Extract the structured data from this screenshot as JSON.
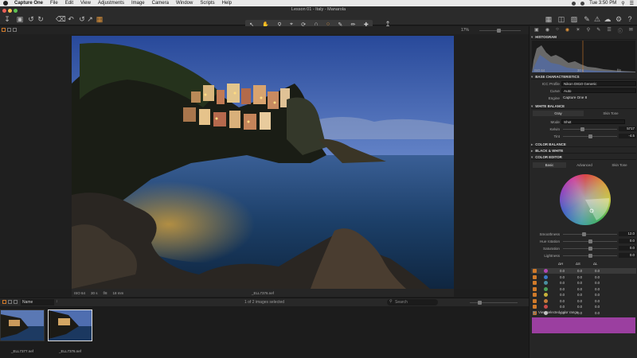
{
  "menubar": {
    "items": [
      "Capture One",
      "File",
      "Edit",
      "View",
      "Adjustments",
      "Image",
      "Camera",
      "Window",
      "Scripts",
      "Help"
    ],
    "clock": "Tue 3:50 PM"
  },
  "window": {
    "title": "Lesson 01 - Italy - Manarola"
  },
  "viewer": {
    "zoom": "17%",
    "info": {
      "iso": "ISO 64",
      "shutter": "30 s",
      "aperture": "f/8",
      "focal": "18 mm"
    },
    "filename": "_ELL7376.nef"
  },
  "browser": {
    "sort_label": "Name",
    "selection_count": "1 of 2 images selected",
    "search_placeholder": "Search",
    "thumbs": [
      {
        "name": "_ELL7377.nef"
      },
      {
        "name": "_ELL7376.nef"
      }
    ]
  },
  "panel": {
    "histogram": {
      "title": "HISTOGRAM",
      "iso": "ISO 64",
      "shutter": "30 s",
      "aperture": "f/8"
    },
    "base": {
      "title": "BASE CHARACTERISTICS",
      "icc_label": "ICC Profile",
      "icc_value": "Nikon D810 Generic",
      "curve_label": "Curve",
      "curve_value": "Auto",
      "engine_label": "Engine",
      "engine_value": "Capture One 8"
    },
    "wb": {
      "title": "WHITE BALANCE",
      "tab_gray": "Gray",
      "tab_skin": "Skin Tone",
      "mode_label": "Mode",
      "mode_value": "Shot",
      "kelvin_label": "Kelvin",
      "kelvin_value": "5717",
      "tint_label": "Tint",
      "tint_value": "-4.5"
    },
    "color_balance": {
      "title": "COLOR BALANCE"
    },
    "bw": {
      "title": "BLACK & WHITE"
    },
    "color_editor": {
      "title": "COLOR EDITOR",
      "tabs": [
        "Basic",
        "Advanced",
        "Skin Tone"
      ],
      "smoothness_label": "Smoothness",
      "smoothness_value": "12.0",
      "hue_label": "Hue rotation",
      "hue_value": "0.0",
      "saturation_label": "Saturation",
      "saturation_value": "0.0",
      "lightness_label": "Lightness",
      "lightness_value": "0.0",
      "col_h": "ΔH",
      "col_s": "ΔS",
      "col_l": "ΔL",
      "rows": [
        {
          "color": "#b347b3",
          "h": "0.0",
          "s": "0.0",
          "l": "0.0"
        },
        {
          "color": "#3a78c8",
          "h": "0.0",
          "s": "0.0",
          "l": "0.0"
        },
        {
          "color": "#4a8fa0",
          "h": "0.0",
          "s": "0.0",
          "l": "0.0"
        },
        {
          "color": "#4aa05a",
          "h": "0.0",
          "s": "0.0",
          "l": "0.0"
        },
        {
          "color": "#c8b23a",
          "h": "0.0",
          "s": "0.0",
          "l": "0.0"
        },
        {
          "color": "#c87a3a",
          "h": "0.0",
          "s": "0.0",
          "l": "0.0"
        },
        {
          "color": "#c84a4a",
          "h": "0.0",
          "s": "0.0",
          "l": "0.0"
        },
        {
          "color": "#c0c0c0",
          "h": "0.0",
          "s": "0.0",
          "l": "0.0"
        }
      ],
      "view_range_label": "View selected color range",
      "range_color": "#9b3fa0"
    }
  }
}
